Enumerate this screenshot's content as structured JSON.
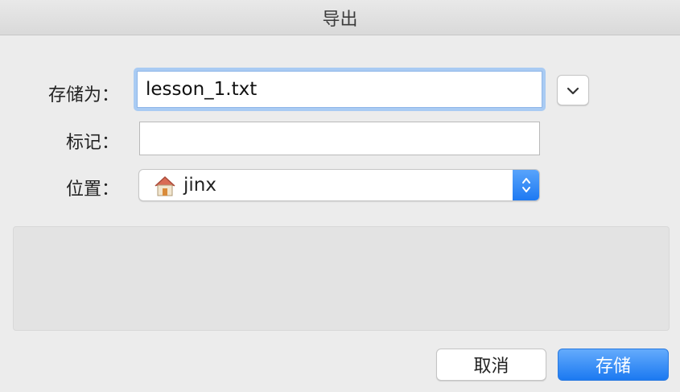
{
  "window": {
    "title": "导出"
  },
  "form": {
    "save_as_label": "存储为：",
    "save_as_value": "lesson_1.txt",
    "tags_label": "标记：",
    "tags_value": "",
    "location_label": "位置：",
    "location_value": "jinx",
    "location_icon": "home-folder-icon"
  },
  "buttons": {
    "cancel": "取消",
    "save": "存储"
  },
  "colors": {
    "accent": "#1b79f1",
    "focus_ring": "#a9cbf3",
    "background": "#ececec"
  }
}
